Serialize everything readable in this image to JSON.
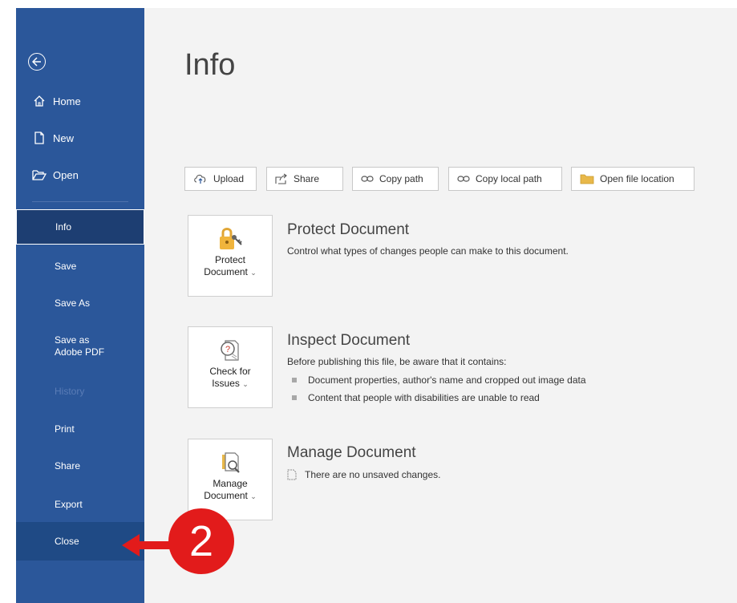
{
  "sidebar": {
    "top_items": [
      {
        "label": "Home",
        "icon": "home-icon"
      },
      {
        "label": "New",
        "icon": "new-document-icon"
      },
      {
        "label": "Open",
        "icon": "open-folder-icon"
      }
    ],
    "items": [
      {
        "label": "Info",
        "state": "selected"
      },
      {
        "label": "Save"
      },
      {
        "label": "Save As"
      },
      {
        "label": "Save as Adobe PDF"
      },
      {
        "label": "History",
        "state": "disabled"
      },
      {
        "label": "Print"
      },
      {
        "label": "Share"
      },
      {
        "label": "Export"
      },
      {
        "label": "Close",
        "state": "highlighted"
      }
    ]
  },
  "main": {
    "title": "Info",
    "toolbar": {
      "upload": "Upload",
      "share": "Share",
      "copy_path": "Copy path",
      "copy_local_path": "Copy local path",
      "open_file_location": "Open file location"
    },
    "protect": {
      "button_line1": "Protect",
      "button_line2": "Document",
      "title": "Protect Document",
      "description": "Control what types of changes people can make to this document."
    },
    "inspect": {
      "button_line1": "Check for",
      "button_line2": "Issues",
      "title": "Inspect Document",
      "description": "Before publishing this file, be aware that it contains:",
      "bullets": [
        "Document properties, author's name and cropped out image data",
        "Content that people with disabilities are unable to read"
      ]
    },
    "manage": {
      "button_line1": "Manage",
      "button_line2": "Document",
      "title": "Manage Document",
      "status": "There are no unsaved changes."
    }
  },
  "annotation": {
    "step_number": "2"
  },
  "colors": {
    "sidebar_bg": "#2b579a",
    "sidebar_selected": "#1d3e72",
    "main_bg": "#f3f3f3",
    "annotation_red": "#e21b1b"
  }
}
